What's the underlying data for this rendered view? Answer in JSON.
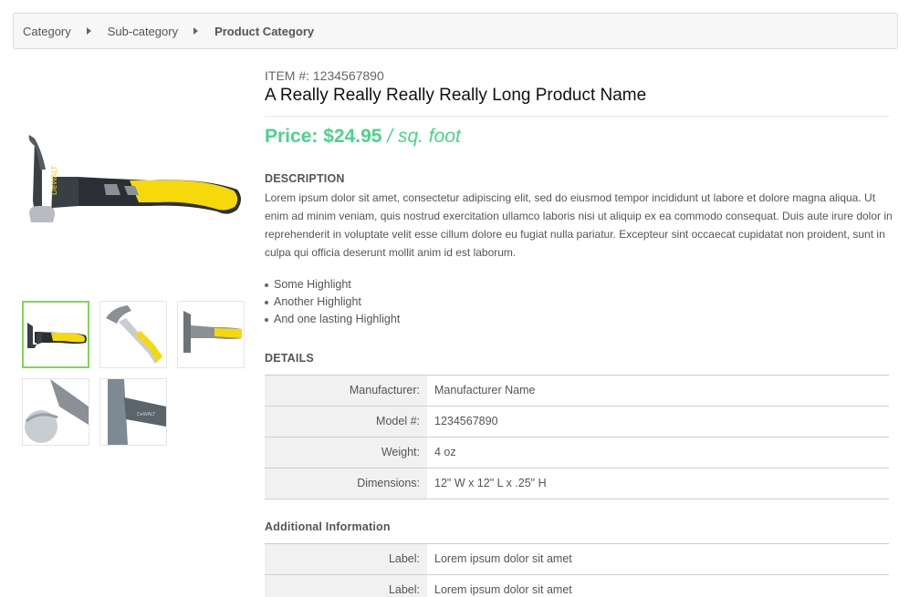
{
  "breadcrumb": [
    {
      "label": "Category"
    },
    {
      "label": "Sub-category"
    },
    {
      "label": "Product Category"
    }
  ],
  "product": {
    "item_number": "ITEM #: 1234567890",
    "name": "A Really Really Really Really Long Product Name",
    "price": {
      "label": "Price: $24.95",
      "unit": "/ sq. foot"
    }
  },
  "colors": {
    "price": "#4cd38a",
    "selected_thumb_border": "#7ed957",
    "hammer_yellow": "#f5d90a",
    "hammer_dark": "#2b2f33"
  },
  "description": {
    "title": "DESCRIPTION",
    "text": "Lorem ipsum dolor sit amet, consectetur adipiscing elit, sed do eiusmod tempor incididunt ut labore et dolore magna aliqua. Ut enim ad minim veniam, quis nostrud exercitation ullamco laboris nisi ut aliquip ex ea commodo consequat. Duis aute irure dolor in reprehenderit in voluptate velit esse cillum dolore eu fugiat nulla pariatur. Excepteur sint occaecat cupidatat non proident, sunt in culpa qui officia deserunt mollit anim id est laborum."
  },
  "highlights": [
    "Some Highlight",
    "Another Highlight",
    "And one lasting Highlight"
  ],
  "details": {
    "title": "DETAILS",
    "rows": [
      {
        "label": "Manufacturer:",
        "value": "Manufacturer Name"
      },
      {
        "label": "Model #:",
        "value": "1234567890"
      },
      {
        "label": "Weight:",
        "value": "4 oz"
      },
      {
        "label": "Dimensions:",
        "value": "12\" W x 12\" L x .25\" H"
      }
    ]
  },
  "additional": {
    "title": "Additional Information",
    "rows": [
      {
        "label": "Label:",
        "value": "Lorem ipsum dolor sit amet"
      },
      {
        "label": "Label:",
        "value": "Lorem ipsum dolor sit amet"
      }
    ]
  },
  "images": {
    "main_logo": "DeWALT",
    "thumb_logo_1": "DeWALT",
    "thumb_logo_5": "DeWALT"
  }
}
